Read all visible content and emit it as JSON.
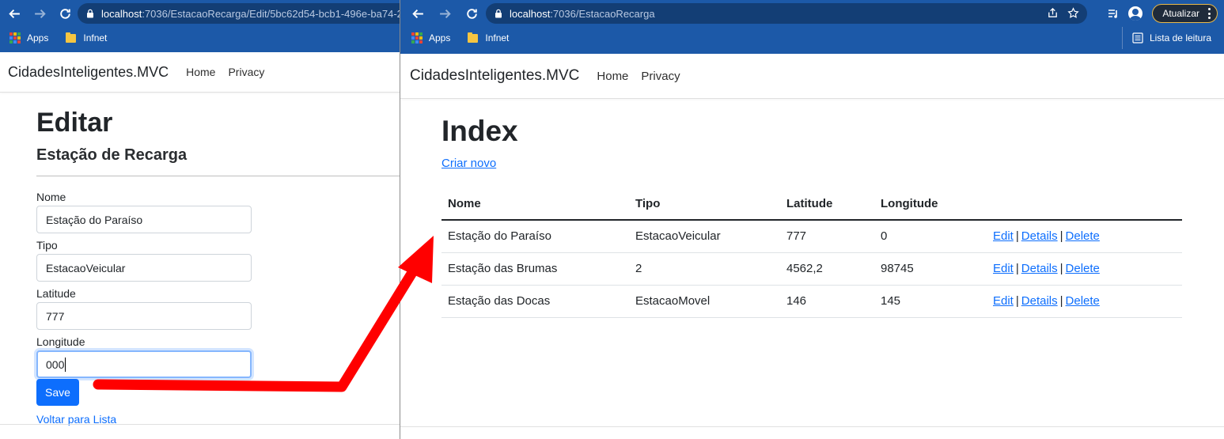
{
  "left_window": {
    "url": {
      "host": "localhost",
      "path": ":7036/EstacaoRecarga/Edit/5bc62d54-bcb1-496e-ba74-2..."
    },
    "bookmarks": [
      {
        "label": "Apps"
      },
      {
        "label": "Infnet"
      }
    ],
    "navbar": {
      "brand": "CidadesInteligentes.MVC",
      "links": [
        "Home",
        "Privacy"
      ]
    },
    "page": {
      "title": "Editar",
      "subtitle": "Estação de Recarga",
      "fields": [
        {
          "label": "Nome",
          "value": "Estação do Paraíso"
        },
        {
          "label": "Tipo",
          "value": "EstacaoVeicular"
        },
        {
          "label": "Latitude",
          "value": "777"
        },
        {
          "label": "Longitude",
          "value": "000"
        }
      ],
      "save_label": "Save",
      "back_link": "Voltar para Lista"
    }
  },
  "right_window": {
    "url": {
      "host": "localhost",
      "path": ":7036/EstacaoRecarga"
    },
    "bookmarks": [
      {
        "label": "Apps"
      },
      {
        "label": "Infnet"
      }
    ],
    "reading_list": "Lista de leitura",
    "update_button": "Atualizar",
    "navbar": {
      "brand": "CidadesInteligentes.MVC",
      "links": [
        "Home",
        "Privacy"
      ]
    },
    "page": {
      "title": "Index",
      "create_link": "Criar novo",
      "table": {
        "headers": [
          "Nome",
          "Tipo",
          "Latitude",
          "Longitude"
        ],
        "actions": [
          "Edit",
          "Details",
          "Delete"
        ],
        "rows": [
          [
            "Estação do Paraíso",
            "EstacaoVeicular",
            "777",
            "0"
          ],
          [
            "Estação das Brumas",
            "2",
            "4562,2",
            "98745"
          ],
          [
            "Estação das Docas",
            "EstacaoMovel",
            "146",
            "145"
          ]
        ]
      }
    }
  },
  "colors": {
    "chrome": "#1c59a8",
    "link": "#0d6efd",
    "primary": "#0d6efd",
    "arrow": "#ff0000"
  }
}
